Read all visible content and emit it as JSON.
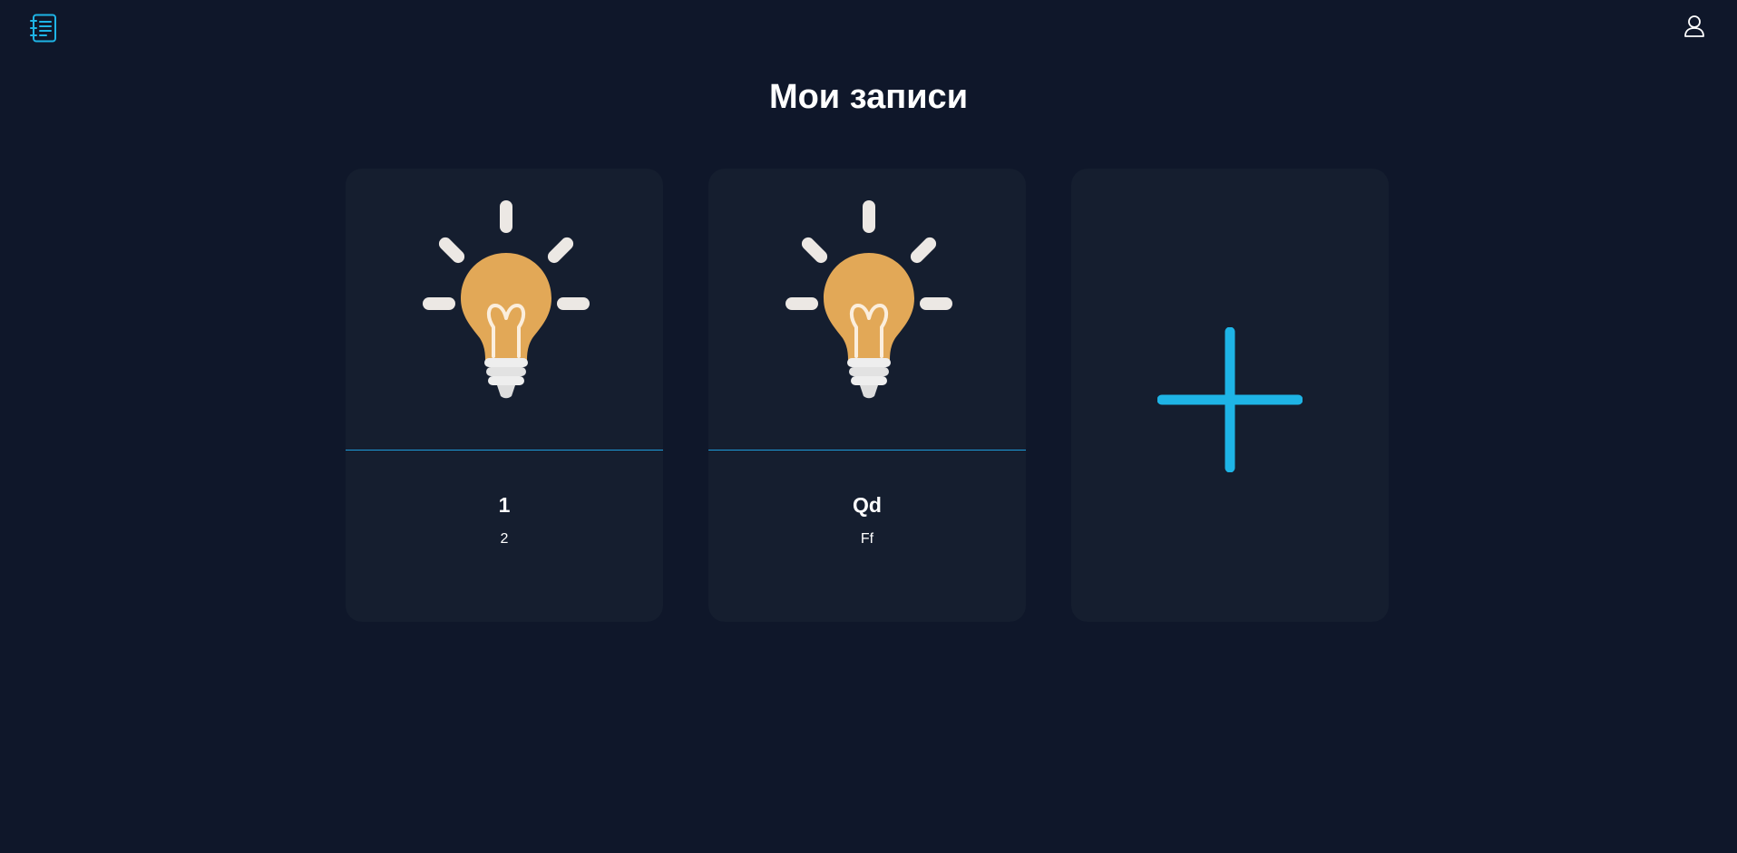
{
  "header": {
    "logo_icon": "notebook-icon",
    "user_icon": "user-icon"
  },
  "main": {
    "title": "Мои записи",
    "cards": [
      {
        "title": "1",
        "description": "2",
        "image": "lightbulb-icon"
      },
      {
        "title": "Qd",
        "description": "Ff",
        "image": "lightbulb-icon"
      }
    ],
    "add_card_icon": "plus-icon"
  },
  "colors": {
    "background": "#0f172a",
    "card": "#151e2f",
    "accent": "#1eb4e6",
    "bulb": "#e2a857"
  }
}
